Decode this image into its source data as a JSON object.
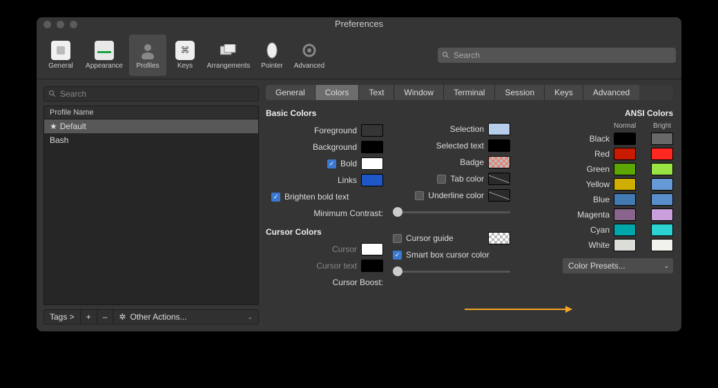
{
  "window": {
    "title": "Preferences"
  },
  "toolbar": {
    "items": [
      {
        "label": "General"
      },
      {
        "label": "Appearance"
      },
      {
        "label": "Profiles",
        "active": true
      },
      {
        "label": "Keys"
      },
      {
        "label": "Arrangements"
      },
      {
        "label": "Pointer"
      },
      {
        "label": "Advanced"
      }
    ],
    "search_placeholder": "Search"
  },
  "sidebar": {
    "search_placeholder": "Search",
    "header": "Profile Name",
    "profiles": [
      {
        "name": "Default",
        "star": true,
        "selected": true
      },
      {
        "name": "Bash",
        "star": false,
        "selected": false
      }
    ],
    "footer": {
      "tags_label": "Tags >",
      "add": "+",
      "remove": "–",
      "other_actions": "Other Actions..."
    }
  },
  "subtabs": [
    "General",
    "Colors",
    "Text",
    "Window",
    "Terminal",
    "Session",
    "Keys",
    "Advanced"
  ],
  "subtabs_active": "Colors",
  "basic": {
    "heading": "Basic Colors",
    "foreground": {
      "label": "Foreground",
      "color": "#ffffff"
    },
    "background": {
      "label": "Background",
      "color": "#000000"
    },
    "bold": {
      "label": "Bold",
      "checked": true,
      "color": "#ffffff"
    },
    "links": {
      "label": "Links",
      "color": "#1f57c9"
    },
    "brighten": {
      "label": "Brighten bold text",
      "checked": true
    },
    "contrast_label": "Minimum Contrast:",
    "selection": {
      "label": "Selection",
      "color": "#b7cdec"
    },
    "selected_text": {
      "label": "Selected text",
      "color": "#000000"
    },
    "badge": {
      "label": "Badge",
      "color": "#d77062"
    },
    "tab_color": {
      "label": "Tab color",
      "checked": false
    },
    "underline": {
      "label": "Underline color",
      "checked": false
    }
  },
  "cursor": {
    "heading": "Cursor Colors",
    "cursor": {
      "label": "Cursor",
      "dim": true,
      "color": "#ffffff"
    },
    "cursor_text": {
      "label": "Cursor text",
      "dim": true,
      "color": "#000000"
    },
    "boost_label": "Cursor Boost:",
    "guide": {
      "label": "Cursor guide",
      "checked": false
    },
    "smart": {
      "label": "Smart box cursor color",
      "checked": true
    }
  },
  "ansi": {
    "heading": "ANSI Colors",
    "normal_label": "Normal",
    "bright_label": "Bright",
    "rows": [
      {
        "name": "Black",
        "normal": "#000000",
        "bright": "#686868"
      },
      {
        "name": "Red",
        "normal": "#c91b00",
        "bright": "#ff2821"
      },
      {
        "name": "Green",
        "normal": "#5ea702",
        "bright": "#99e343"
      },
      {
        "name": "Yellow",
        "normal": "#cfae00",
        "bright": "#6699d6"
      },
      {
        "name": "Blue",
        "normal": "#427ab3",
        "bright": "#5a8dcb"
      },
      {
        "name": "Magenta",
        "normal": "#89658e",
        "bright": "#c9a0dc"
      },
      {
        "name": "Cyan",
        "normal": "#00a7aa",
        "bright": "#2cd1d1"
      },
      {
        "name": "White",
        "normal": "#dbded8",
        "bright": "#f1f1ed"
      }
    ]
  },
  "presets_label": "Color Presets..."
}
